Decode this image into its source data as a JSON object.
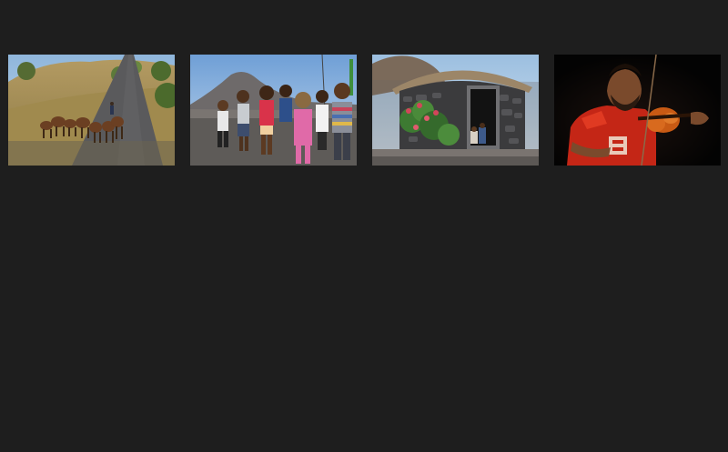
{
  "gallery": {
    "items": [
      {
        "subject": "goats-on-road"
      },
      {
        "subject": "children-on-road"
      },
      {
        "subject": "stone-round-hut"
      },
      {
        "subject": "violinist"
      }
    ]
  }
}
